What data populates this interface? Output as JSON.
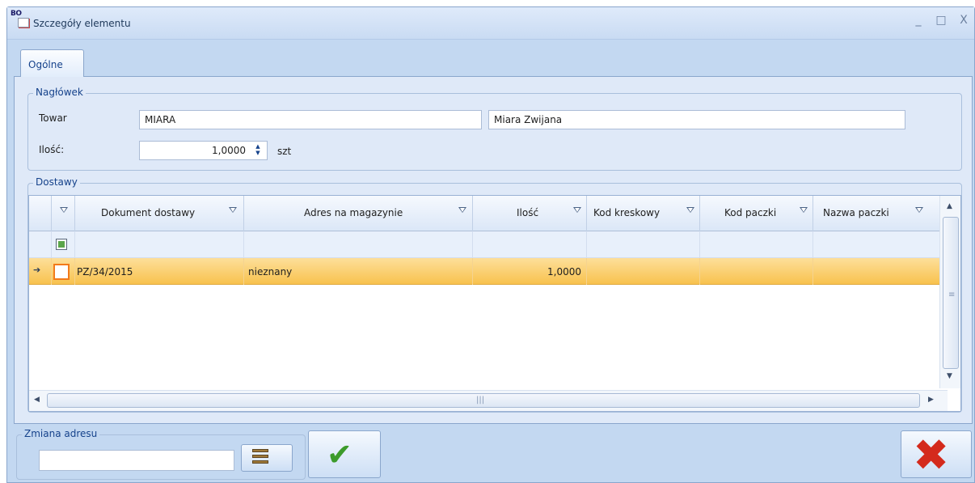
{
  "window": {
    "title": "Szczegóły elementu",
    "app_badge": "BO",
    "controls": [
      "_",
      "□",
      "X"
    ]
  },
  "tabs": [
    {
      "label": "Ogólne",
      "active": true
    }
  ],
  "header_group": {
    "legend": "Nagłówek",
    "towar_label": "Towar",
    "towar_code": "MIARA",
    "towar_name": "Miara Zwijana",
    "ilosc_label": "Ilość:",
    "ilosc_value": "1,0000",
    "unit": "szt"
  },
  "deliveries_group": {
    "legend": "Dostawy",
    "columns": [
      "Dokument dostawy",
      "Adres na magazynie",
      "Ilość",
      "Kod kreskowy",
      "Kod paczki",
      "Nazwa paczki"
    ],
    "rows": [
      {
        "dokument": "PZ/34/2015",
        "adres": "nieznany",
        "ilosc": "1,0000",
        "kod_kreskowy": "",
        "kod_paczki": "",
        "nazwa_paczki": ""
      }
    ]
  },
  "address_change": {
    "legend": "Zmiana adresu",
    "value": ""
  },
  "icons": {
    "pick": "shelf-icon",
    "confirm": "checkmark-icon",
    "cancel": "red-x-icon"
  },
  "colors": {
    "selected_row": "#f8c24e",
    "confirm": "#3c9b2b",
    "cancel": "#d42a1c"
  }
}
